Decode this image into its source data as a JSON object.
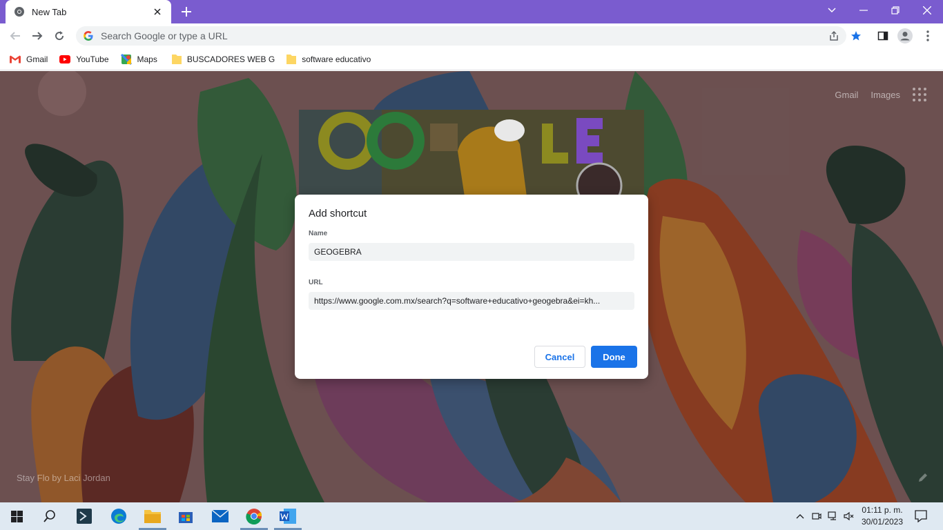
{
  "browser": {
    "tab_title": "New Tab",
    "omnibox_placeholder": "Search Google or type a URL",
    "bookmarks": [
      {
        "label": "Gmail",
        "icon": "gmail-icon"
      },
      {
        "label": "YouTube",
        "icon": "youtube-icon"
      },
      {
        "label": "Maps",
        "icon": "maps-icon"
      },
      {
        "label": "BUSCADORES WEB G",
        "icon": "folder-icon"
      },
      {
        "label": "software educativo",
        "icon": "folder-icon"
      }
    ],
    "accent_color": "#7a5ccf"
  },
  "newtab": {
    "gmail_link": "Gmail",
    "images_link": "Images",
    "attribution": "Stay Flo by Laci Jordan"
  },
  "dialog": {
    "title": "Add shortcut",
    "name_label": "Name",
    "name_value": "GEOGEBRA",
    "url_label": "URL",
    "url_value": "https://www.google.com.mx/search?q=software+educativo+geogebra&ei=kh...",
    "cancel_label": "Cancel",
    "done_label": "Done",
    "primary_color": "#1a73e8"
  },
  "taskbar": {
    "time": "01:11 p. m.",
    "date": "30/01/2023"
  }
}
